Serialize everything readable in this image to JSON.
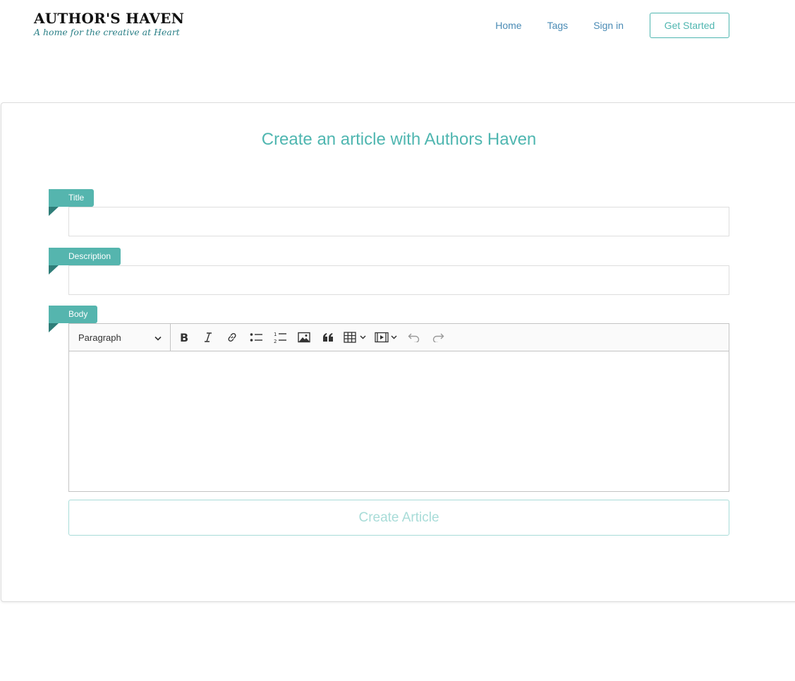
{
  "brand": {
    "name": "AUTHOR'S HAVEN",
    "tagline": "A home for the creative at Heart"
  },
  "nav": {
    "home": "Home",
    "tags": "Tags",
    "sign_in": "Sign in",
    "get_started": "Get Started"
  },
  "form": {
    "heading": "Create an article with Authors Haven",
    "title_label": "Title",
    "title_value": "",
    "description_label": "Description",
    "description_value": "",
    "body_label": "Body",
    "submit_label": "Create Article"
  },
  "editor": {
    "block_format": "Paragraph",
    "toolbar": [
      "bold-icon",
      "italic-icon",
      "link-icon",
      "bulleted-list-icon",
      "numbered-list-icon",
      "image-icon",
      "quote-icon",
      "table-icon",
      "media-icon",
      "undo-icon",
      "redo-icon"
    ],
    "body_text": ""
  },
  "colors": {
    "accent": "#4fb6b0",
    "ribbon": "#55b5ae",
    "ribbon_fold": "#2e7d78",
    "nav_link": "#4a8bb5"
  }
}
